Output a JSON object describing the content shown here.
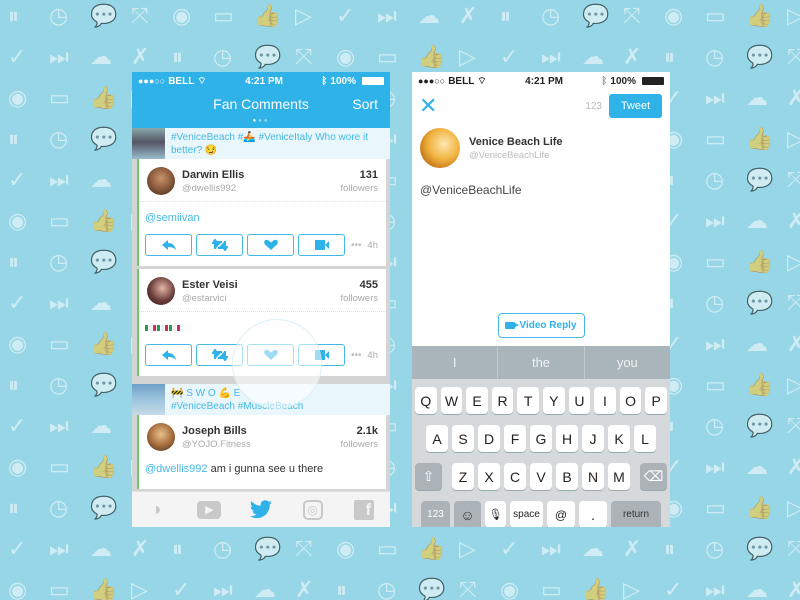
{
  "background": {
    "color": "#96d6e6",
    "pattern_icons": [
      "pause-icon",
      "clock-icon",
      "chat-bubble-icon",
      "expand-icon",
      "eye-icon",
      "video-icon",
      "thumbs-up-icon",
      "play-icon",
      "check-icon",
      "skip-icon",
      "cloud-icon",
      "mute-icon"
    ]
  },
  "colors": {
    "accent": "#2eb2e8",
    "mention": "#45b9e6",
    "keyboard": "#d6d9dc"
  },
  "left_phone": {
    "status": {
      "signal": "●●●○○",
      "carrier": "BELL",
      "time": "4:21 PM",
      "battery": "100%"
    },
    "nav": {
      "title": "Fan Comments",
      "sort": "Sort",
      "page_dots": 3,
      "active_page": 1
    },
    "context_top": {
      "text": "#VeniceBeach #🚣   #VeniceItaly Who wore it better? 😏"
    },
    "comments": [
      {
        "name": "Darwin Ellis",
        "handle": "@dwellis992",
        "followers": "131",
        "followers_label": "followers",
        "mention": "@semiivan",
        "text": "",
        "time": "4h",
        "more": "•••"
      },
      {
        "name": "Ester Veisi",
        "handle": "@estarvici",
        "followers": "455",
        "followers_label": "followers",
        "mention": "",
        "text": "🇮🇹🇮🇹🇮🇹",
        "time": "4h",
        "more": "•••"
      }
    ],
    "context_bottom": {
      "line1": "🚧 S W O 💪 E",
      "line2": "#VeniceBeach #MuscleBeach"
    },
    "comment3": {
      "name": "Joseph Bills",
      "handle": "@YOJO.Fitness",
      "followers": "2.1k",
      "followers_label": "followers",
      "mention": "@dwellis992",
      "text": " am i gunna see u there"
    },
    "actions": [
      "reply",
      "retweet",
      "like",
      "video-reply"
    ],
    "tabbar": [
      {
        "name": "vine",
        "glyph": "◗"
      },
      {
        "name": "youtube",
        "glyph": "▶"
      },
      {
        "name": "twitter",
        "glyph": "🐦",
        "active": true
      },
      {
        "name": "instagram",
        "glyph": "◎"
      },
      {
        "name": "facebook",
        "glyph": "f"
      }
    ]
  },
  "right_phone": {
    "status": {
      "signal": "●●●○○",
      "carrier": "BELL",
      "time": "4:21 PM",
      "battery": "100%"
    },
    "close": "✕",
    "char_count": "123",
    "tweet_label": "Tweet",
    "account": {
      "name": "Venice Beach Life",
      "handle": "@VeniceBeachLife"
    },
    "draft_text": "@VeniceBeachLife",
    "video_reply_label": "Video Reply",
    "suggestions": [
      "I",
      "the",
      "you"
    ],
    "keyboard": {
      "row1": [
        "Q",
        "W",
        "E",
        "R",
        "T",
        "Y",
        "U",
        "I",
        "O",
        "P"
      ],
      "row2": [
        "A",
        "S",
        "D",
        "F",
        "G",
        "H",
        "J",
        "K",
        "L"
      ],
      "row3": [
        "Z",
        "X",
        "C",
        "V",
        "B",
        "N",
        "M"
      ],
      "shift": "⇧",
      "delete": "⌫",
      "numbers": "123",
      "emoji": "☺",
      "mic": "🎙",
      "space": "space",
      "at": "@",
      "period": ".",
      "return": "return"
    }
  }
}
